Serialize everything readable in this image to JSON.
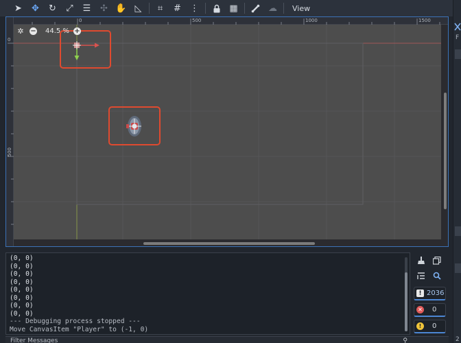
{
  "toolbar": {
    "tools": [
      {
        "icon": "select-arrow-icon",
        "glyph": "➤"
      },
      {
        "icon": "move-icon",
        "glyph": "✥",
        "active": true
      },
      {
        "icon": "rotate-icon",
        "glyph": "↻"
      },
      {
        "icon": "scale-icon",
        "glyph": "⤢"
      },
      {
        "icon": "list-select-icon",
        "glyph": "☰"
      },
      {
        "icon": "pivot-icon",
        "glyph": "✣",
        "dim": true
      },
      {
        "icon": "pan-hand-icon",
        "glyph": "✋"
      },
      {
        "icon": "ruler-icon",
        "glyph": "◺"
      },
      {
        "icon": "smart-snap-icon",
        "glyph": "⌗"
      },
      {
        "icon": "grid-snap-icon",
        "glyph": "#"
      },
      {
        "icon": "more-options-icon",
        "glyph": "⋮"
      },
      {
        "icon": "lock-icon",
        "glyph": "🔒"
      },
      {
        "icon": "group-icon",
        "glyph": "▦"
      },
      {
        "icon": "skeleton-bone-icon",
        "glyph": "⚲"
      },
      {
        "icon": "cloud-icon",
        "glyph": "☁",
        "dim": true
      }
    ],
    "view_label": "View"
  },
  "viewport": {
    "zoom_label": "44.5 %",
    "ruler_top_labels": [
      "0",
      "500",
      "1000",
      "1500"
    ],
    "ruler_left_labels": [
      "0",
      "500"
    ],
    "accent_red": "#e04a2f",
    "axis_red": "#d9534f",
    "axis_green": "#8fd14f"
  },
  "output": {
    "lines": [
      "(0, 0)",
      "(0, 0)",
      "(0, 0)",
      "(0, 0)",
      "(0, 0)",
      "(0, 0)",
      "(0, 0)",
      "(0, 0)",
      "--- Debugging process stopped ---",
      "Move CanvasItem \"Player\" to (-1, 0)"
    ],
    "counters": {
      "warnings_total": "2036",
      "errors": "0",
      "warnings": "0"
    },
    "filter_placeholder": "Filter Messages"
  },
  "right_dock": {
    "letter": "F",
    "bottom_count": "2"
  }
}
